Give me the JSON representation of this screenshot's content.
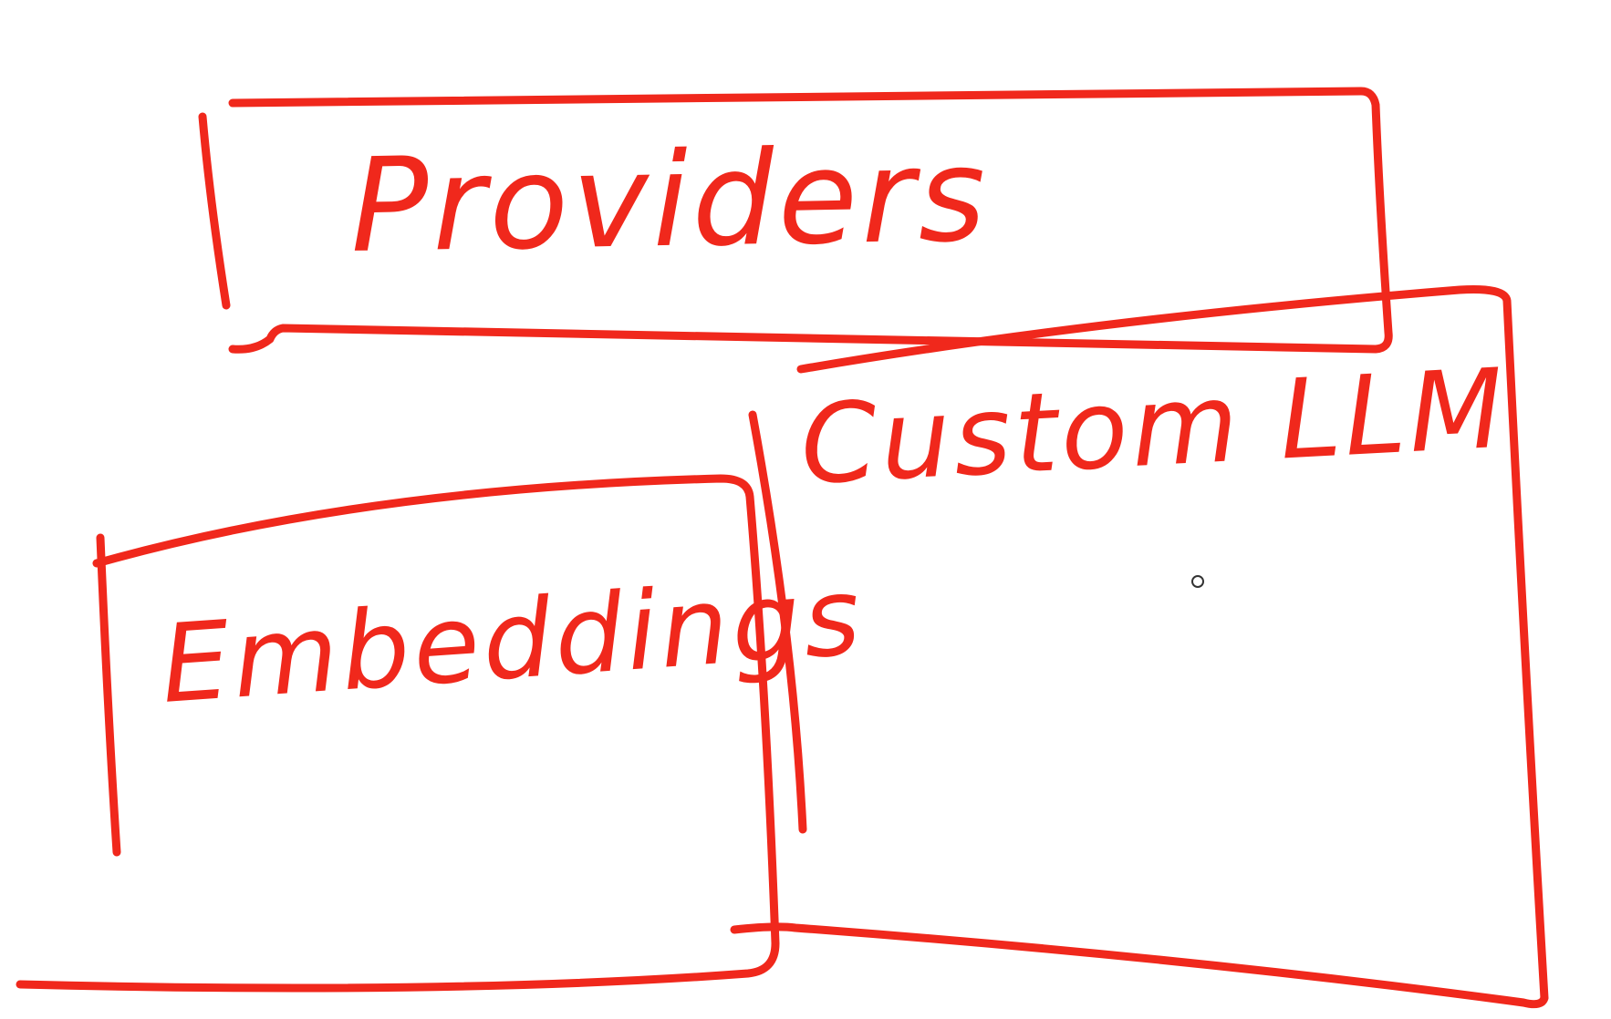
{
  "canvas": {
    "background": "#ffffff",
    "ink_color": "#f0281c"
  },
  "boxes": {
    "providers": {
      "label": "Providers"
    },
    "custom_llm": {
      "label": "Custom LLM"
    },
    "embeddings": {
      "label": "Embeddings"
    }
  }
}
